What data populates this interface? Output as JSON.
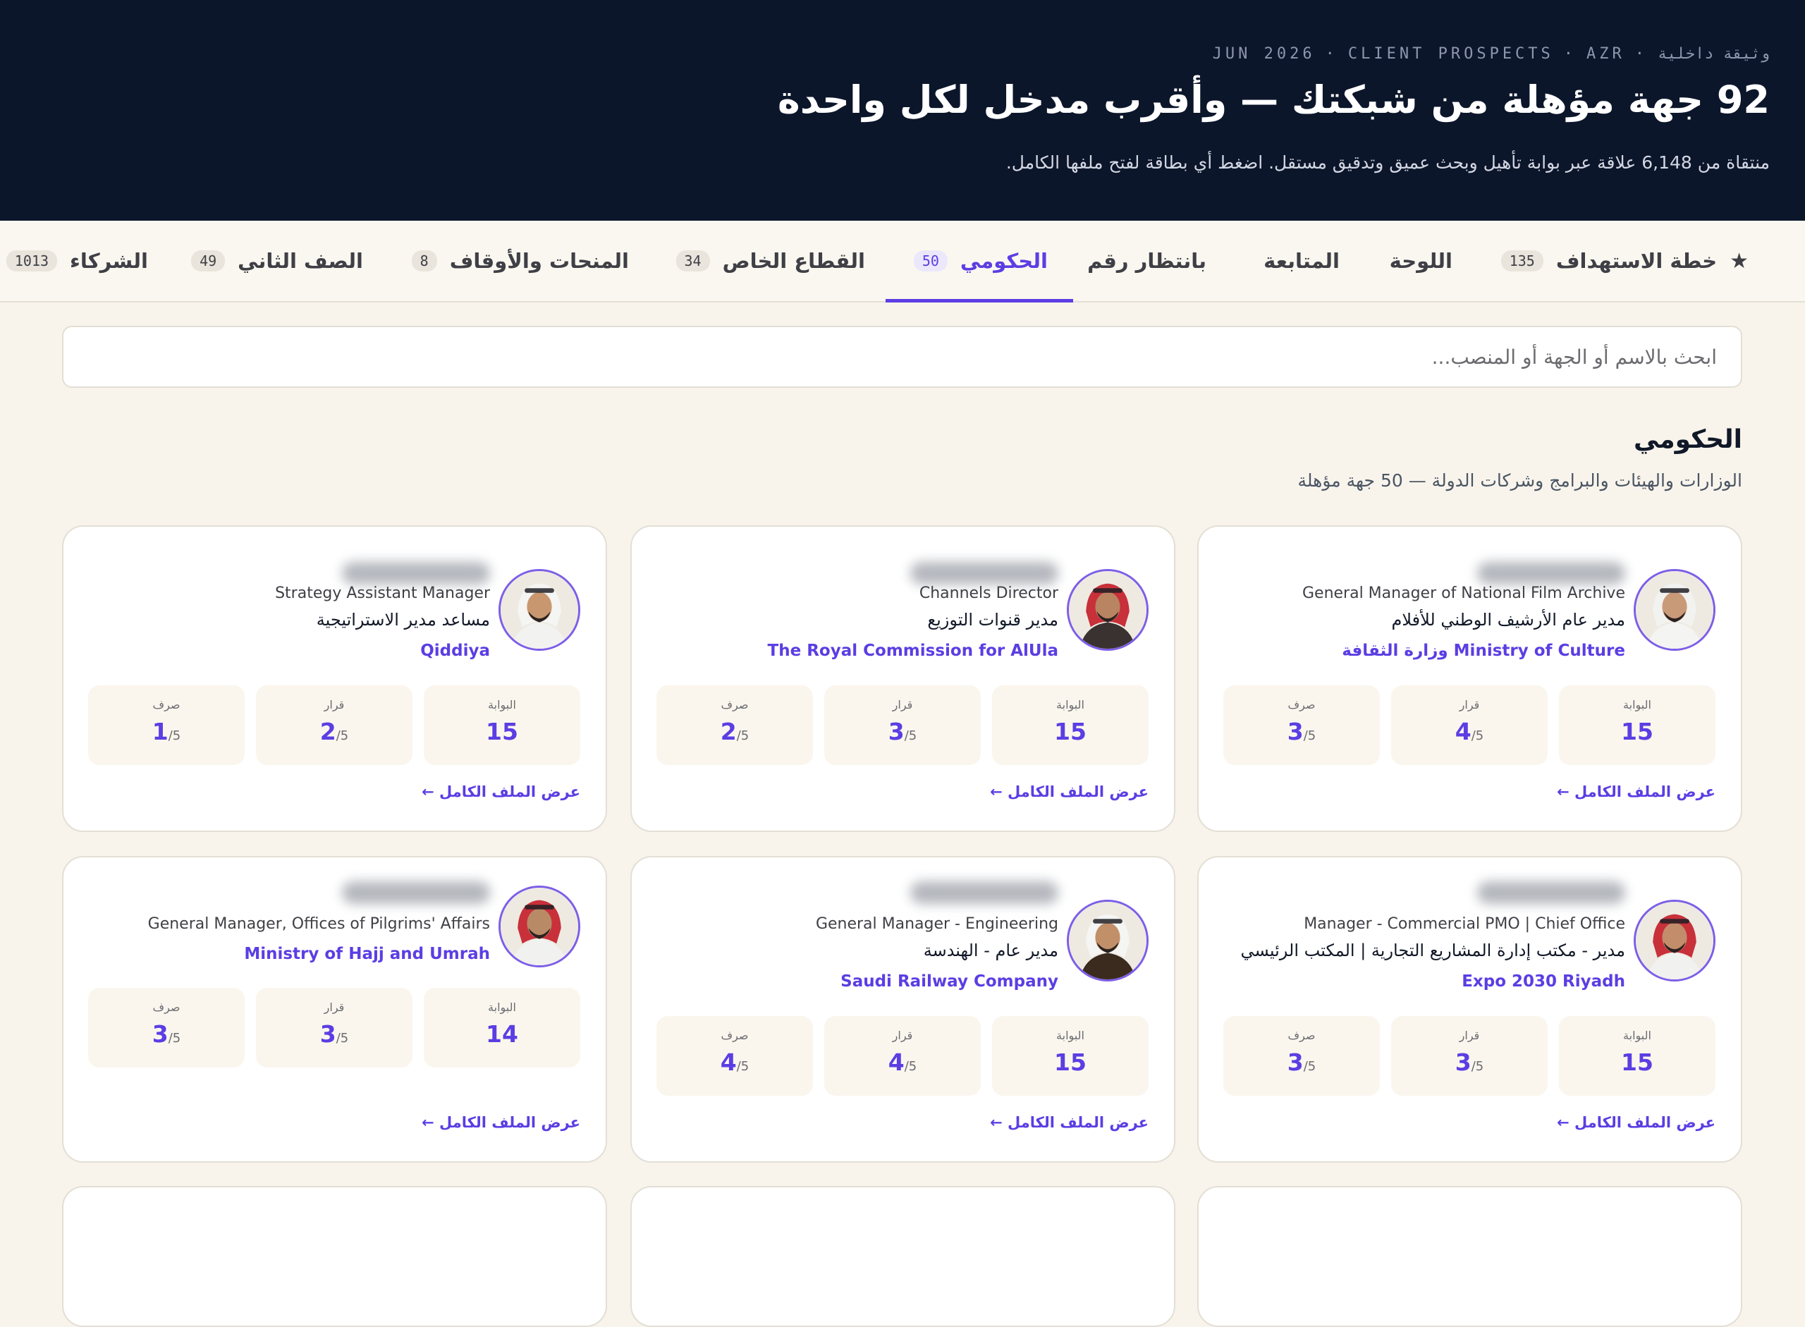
{
  "header": {
    "meta_ar": "وثيقة داخلية",
    "meta_brand": "AZR",
    "meta_title": "CLIENT PROSPECTS",
    "meta_date": "JUN 2026",
    "separator": "·",
    "title": "92 جهة مؤهلة من شبكتك — وأقرب مدخل لكل واحدة",
    "subtitle": "منتقاة من 6,148 علاقة عبر بوابة تأهيل وبحث عميق وتدقيق مستقل. اضغط أي بطاقة لفتح ملفها الكامل."
  },
  "tabs": [
    {
      "label": "خطة الاستهداف",
      "count": "135",
      "star": "★"
    },
    {
      "label": "اللوحة",
      "count": ""
    },
    {
      "label": "المتابعة",
      "count": ""
    },
    {
      "label": "بانتظار رقم",
      "count": ""
    },
    {
      "label": "الحكومي",
      "count": "50",
      "active": true
    },
    {
      "label": "القطاع الخاص",
      "count": "34"
    },
    {
      "label": "المنحات والأوقاف",
      "count": "8"
    },
    {
      "label": "الصف الثاني",
      "count": "49"
    },
    {
      "label": "الشركاء",
      "count": "1013"
    }
  ],
  "search": {
    "placeholder": "ابحث بالاسم أو الجهة أو المنصب..."
  },
  "section": {
    "title": "الحكومي",
    "subtitle": "الوزارات والهيئات والبرامج وشركات الدولة — 50 جهة مؤهلة"
  },
  "labels": {
    "gate": "البوابة",
    "decision": "قرار",
    "spend": "صرف",
    "out_of": "/5",
    "view_profile": "عرض الملف الكامل ←"
  },
  "cards": [
    {
      "role_en": "General Manager of National Film Archive",
      "role_ar": "مدير عام الأرشيف الوطني للأفلام",
      "org": "Ministry of Culture وزارة الثقافة",
      "gate": "15",
      "decision": "4",
      "spend": "3",
      "skin": "#c99a78",
      "garb": "#f4f4f2",
      "head": "#f2f2f0"
    },
    {
      "role_en": "Channels Director",
      "role_ar": "مدير قنوات التوزيع",
      "org": "The Royal Commission for AlUla",
      "gate": "15",
      "decision": "3",
      "spend": "2",
      "skin": "#b98462",
      "garb": "#3a3230",
      "head": "#c8303a"
    },
    {
      "role_en": "Strategy Assistant Manager",
      "role_ar": "مساعد مدير الاستراتيجية",
      "org": "Qiddiya",
      "gate": "15",
      "decision": "2",
      "spend": "1",
      "skin": "#c9976f",
      "garb": "#f2f2f0",
      "head": "#f5f5f3"
    },
    {
      "role_en": "Manager - Commercial PMO | Chief Office",
      "role_ar": "مدير - مكتب إدارة المشاريع التجارية | المكتب الرئيسي",
      "org": "Expo 2030 Riyadh",
      "gate": "15",
      "decision": "3",
      "spend": "3",
      "skin": "#c38c6a",
      "garb": "#f1f1ef",
      "head": "#c8303a"
    },
    {
      "role_en": "General Manager - Engineering",
      "role_ar": "مدير عام - الهندسة",
      "org": "Saudi Railway Company",
      "gate": "15",
      "decision": "4",
      "spend": "4",
      "skin": "#c19069",
      "garb": "#3a2b1e",
      "head": "#f5f5f3"
    },
    {
      "role_en": "General Manager, Offices of Pilgrims' Affairs",
      "role_ar": "",
      "org": "Ministry of Hajj and Umrah",
      "gate": "14",
      "decision": "3",
      "spend": "3",
      "skin": "#b98a66",
      "garb": "#f1f1ef",
      "head": "#c8303a"
    }
  ]
}
